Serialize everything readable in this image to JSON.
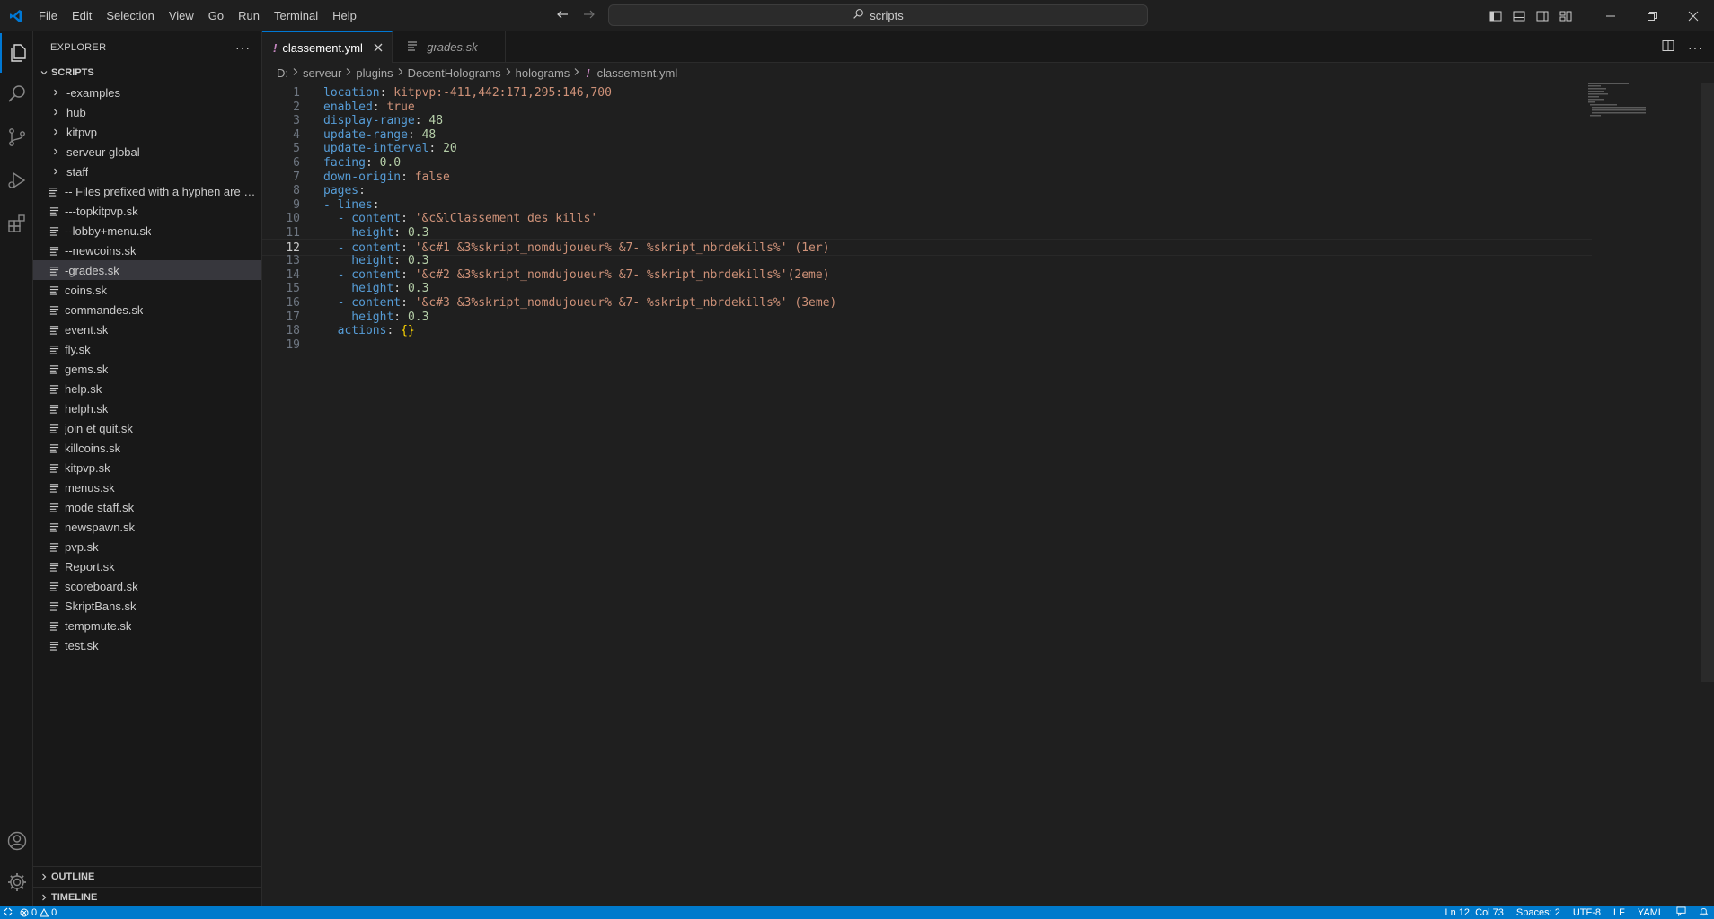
{
  "titlebar": {
    "menu": [
      "File",
      "Edit",
      "Selection",
      "View",
      "Go",
      "Run",
      "Terminal",
      "Help"
    ],
    "search": "scripts"
  },
  "sidebar": {
    "title": "EXPLORER",
    "more": "···",
    "root": "SCRIPTS",
    "folders": [
      "-examples",
      "hub",
      "kitpvp",
      "serveur global",
      "staff"
    ],
    "files": [
      "-- Files prefixed with a hyphen are di...",
      "---topkitpvp.sk",
      "--lobby+menu.sk",
      "--newcoins.sk",
      "-grades.sk",
      "coins.sk",
      "commandes.sk",
      "event.sk",
      "fly.sk",
      "gems.sk",
      "help.sk",
      "helph.sk",
      "join et quit.sk",
      "killcoins.sk",
      "kitpvp.sk",
      "menus.sk",
      "mode staff.sk",
      "newspawn.sk",
      "pvp.sk",
      "Report.sk",
      "scoreboard.sk",
      "SkriptBans.sk",
      "tempmute.sk",
      "test.sk"
    ],
    "outline": "OUTLINE",
    "timeline": "TIMELINE"
  },
  "tabs": [
    {
      "label": "classement.yml",
      "prefix": "!",
      "active": true
    },
    {
      "label": "-grades.sk",
      "prefix": "",
      "active": false
    }
  ],
  "breadcrumb": [
    "D:",
    "serveur",
    "plugins",
    "DecentHolograms",
    "holograms",
    "classement.yml"
  ],
  "breadcrumb_file_icon": "!",
  "editor": {
    "lines": [
      [
        "location",
        ": ",
        "kitpvp:-411,442:171,295:146,700"
      ],
      [
        "enabled",
        ": ",
        "true"
      ],
      [
        "display-range",
        ": ",
        "48"
      ],
      [
        "update-range",
        ": ",
        "48"
      ],
      [
        "update-interval",
        ": ",
        "20"
      ],
      [
        "facing",
        ": ",
        "0.0"
      ],
      [
        "down-origin",
        ": ",
        "false"
      ],
      [
        "pages",
        ":",
        ""
      ],
      [
        "- lines",
        ":",
        ""
      ],
      [
        "  - content",
        ": ",
        "'&c&lClassement des kills'"
      ],
      [
        "    height",
        ": ",
        "0.3"
      ],
      [
        "  - content",
        ": ",
        "'&c#1 &3%skript_nomdujoueur% &7- %skript_nbrdekills%' (1er)"
      ],
      [
        "    height",
        ": ",
        "0.3"
      ],
      [
        "  - content",
        ": ",
        "'&c#2 &3%skript_nomdujoueur% &7- %skript_nbrdekills%'(2eme)"
      ],
      [
        "    height",
        ": ",
        "0.3"
      ],
      [
        "  - content",
        ": ",
        "'&c#3 &3%skript_nomdujoueur% &7- %skript_nbrdekills%' (3eme)"
      ],
      [
        "    height",
        ": ",
        "0.3"
      ],
      [
        "  actions",
        ": ",
        "{}"
      ],
      [
        "",
        "",
        ""
      ]
    ],
    "line_numbers": [
      "1",
      "2",
      "3",
      "4",
      "5",
      "6",
      "7",
      "8",
      "9",
      "10",
      "11",
      "12",
      "13",
      "14",
      "15",
      "16",
      "17",
      "18",
      "19"
    ],
    "current_line": 12
  },
  "statusbar": {
    "errors": "0",
    "warnings": "0",
    "position": "Ln 12, Col 73",
    "spaces": "Spaces: 2",
    "encoding": "UTF-8",
    "eol": "LF",
    "language": "YAML"
  },
  "colors": {
    "accent": "#007acc",
    "key": "#569cd6",
    "string": "#ce9178",
    "yaml_icon": "#c586c0"
  }
}
